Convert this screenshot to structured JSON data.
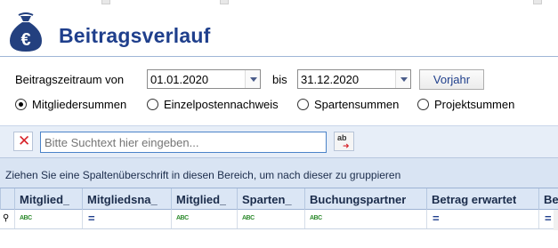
{
  "app": {
    "title": "Beitragsverlauf",
    "logo_icon": "money-bag-euro-icon"
  },
  "filter": {
    "period_label": "Beitragszeitraum von",
    "from_value": "01.01.2020",
    "to_label": "bis",
    "to_value": "31.12.2020",
    "prev_year_button": "Vorjahr"
  },
  "radios": [
    {
      "label": "Mitgliedersummen",
      "selected": true
    },
    {
      "label": "Einzelpostennachweis",
      "selected": false
    },
    {
      "label": "Spartensummen",
      "selected": false
    },
    {
      "label": "Projektsummen",
      "selected": false
    }
  ],
  "search": {
    "placeholder": "Bitte Suchtext hier eingeben...",
    "clear_icon": "close-icon",
    "find_icon": "spell-search-icon"
  },
  "group_panel": {
    "text": "Ziehen Sie eine Spaltenüberschrift in diesen Bereich, um nach dieser zu gruppieren"
  },
  "grid": {
    "columns": [
      {
        "label": "Mitglied_",
        "filter": "abc"
      },
      {
        "label": "Mitgliedsna_",
        "filter": "eq"
      },
      {
        "label": "Mitglied_",
        "filter": "abc"
      },
      {
        "label": "Sparten_",
        "filter": "abc"
      },
      {
        "label": "Buchungspartner",
        "filter": "abc"
      },
      {
        "label": "Betrag erwartet",
        "filter": "eq"
      },
      {
        "label": "Be",
        "filter": "eq"
      }
    ]
  },
  "colors": {
    "accent": "#1f3f8c",
    "panel": "#e7eef8",
    "group_panel": "#d9e4f3",
    "clear_red": "#d8232a"
  }
}
